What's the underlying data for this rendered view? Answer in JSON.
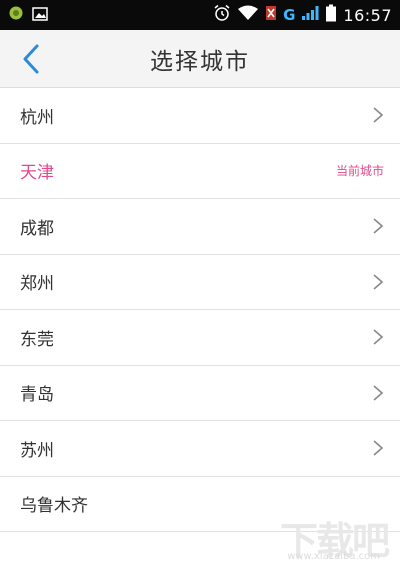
{
  "status_bar": {
    "time": "16:57",
    "network": "G",
    "icons": [
      "app-circle-icon",
      "gallery-icon",
      "alarm-icon",
      "wifi-icon",
      "no-sim-icon",
      "signal-icon",
      "battery-icon"
    ]
  },
  "header": {
    "title": "选择城市",
    "back_icon": "chevron-left-icon"
  },
  "cities": [
    {
      "name": "杭州",
      "current": false
    },
    {
      "name": "天津",
      "current": true,
      "tag": "当前城市"
    },
    {
      "name": "成都",
      "current": false
    },
    {
      "name": "郑州",
      "current": false
    },
    {
      "name": "东莞",
      "current": false
    },
    {
      "name": "青岛",
      "current": false
    },
    {
      "name": "苏州",
      "current": false
    },
    {
      "name": "乌鲁木齐",
      "current": false
    }
  ],
  "watermark": {
    "text": "下载吧",
    "url": "www.xiazaiba.com"
  },
  "colors": {
    "accent": "#2e8ad8",
    "current_city": "#e0498d",
    "status_bar_bg": "#0a0a0a"
  }
}
